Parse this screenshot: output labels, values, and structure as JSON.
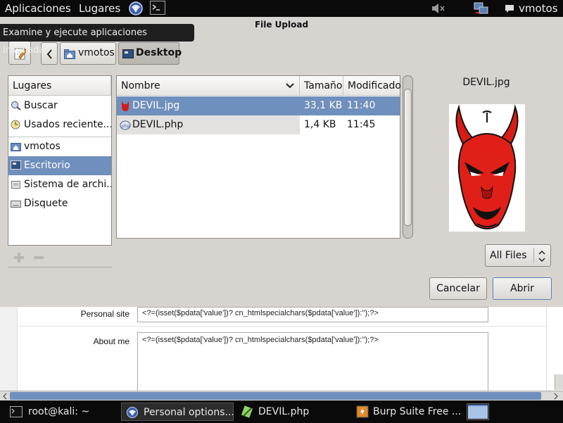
{
  "top_panel": {
    "applications_label": "Aplicaciones",
    "places_label": "Lugares",
    "user_label": "vmotos"
  },
  "tooltip": {
    "text": "Examine y ejecute aplicaciones instaladas"
  },
  "dialog": {
    "title": "File Upload",
    "path_buttons": [
      "vmotos",
      "Desktop"
    ],
    "places_header": "Lugares",
    "places": [
      {
        "label": "Buscar",
        "icon": "search-icon"
      },
      {
        "label": "Usados reciente...",
        "icon": "clock-icon"
      },
      {
        "label": "vmotos",
        "icon": "home-folder-icon"
      },
      {
        "label": "Escritorio",
        "icon": "desktop-icon",
        "selected": true
      },
      {
        "label": "Sistema de archi...",
        "icon": "drive-icon"
      },
      {
        "label": "Disquete",
        "icon": "floppy-icon"
      }
    ],
    "columns": {
      "name": "Nombre",
      "size": "Tamaño",
      "modified": "Modificado"
    },
    "files": [
      {
        "name": "DEVIL.jpg",
        "size": "33,1 KB",
        "modified": "11:40",
        "selected": true
      },
      {
        "name": "DEVIL.php",
        "size": "1,4 KB",
        "modified": "11:45"
      }
    ],
    "preview_name": "DEVIL.jpg",
    "filter_value": "All Files",
    "cancel_label": "Cancelar",
    "open_label": "Abrir"
  },
  "webpage": {
    "personal_site_label": "Personal site",
    "personal_site_value": "<?=(isset($pdata['value'])? cn_htmlspecialchars($pdata['value']):'');?>",
    "about_label": "About me",
    "about_value": "<?=(isset($pdata['value'])? cn_htmlspecialchars($pdata['value']):'');?>"
  },
  "taskbar": {
    "tasks": [
      "root@kali: ~",
      "Personal options...",
      "DEVIL.php",
      "Burp Suite Free ..."
    ]
  }
}
